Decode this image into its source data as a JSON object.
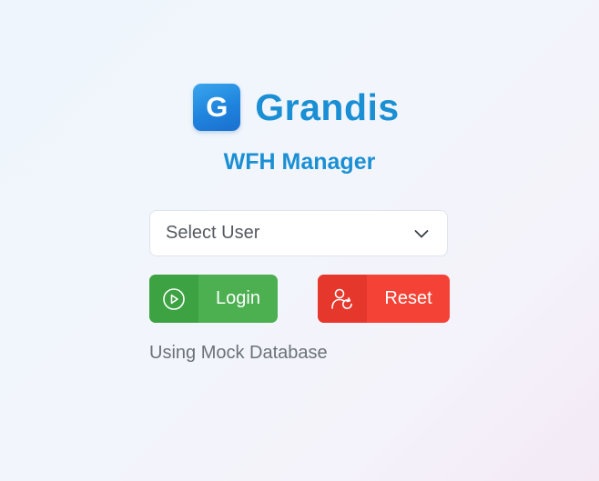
{
  "brand": {
    "logo_letter": "G",
    "name": "Grandis"
  },
  "subtitle": "WFH Manager",
  "user_select": {
    "selected": "Select User",
    "icon": "chevron-down-icon"
  },
  "buttons": {
    "login": {
      "label": "Login",
      "icon": "play-circle-icon"
    },
    "reset": {
      "label": "Reset",
      "icon": "user-refresh-icon"
    }
  },
  "status_text": "Using Mock Database",
  "colors": {
    "brand_blue": "#1b8fd4",
    "login_green": "#4caf50",
    "reset_red": "#f44336"
  }
}
